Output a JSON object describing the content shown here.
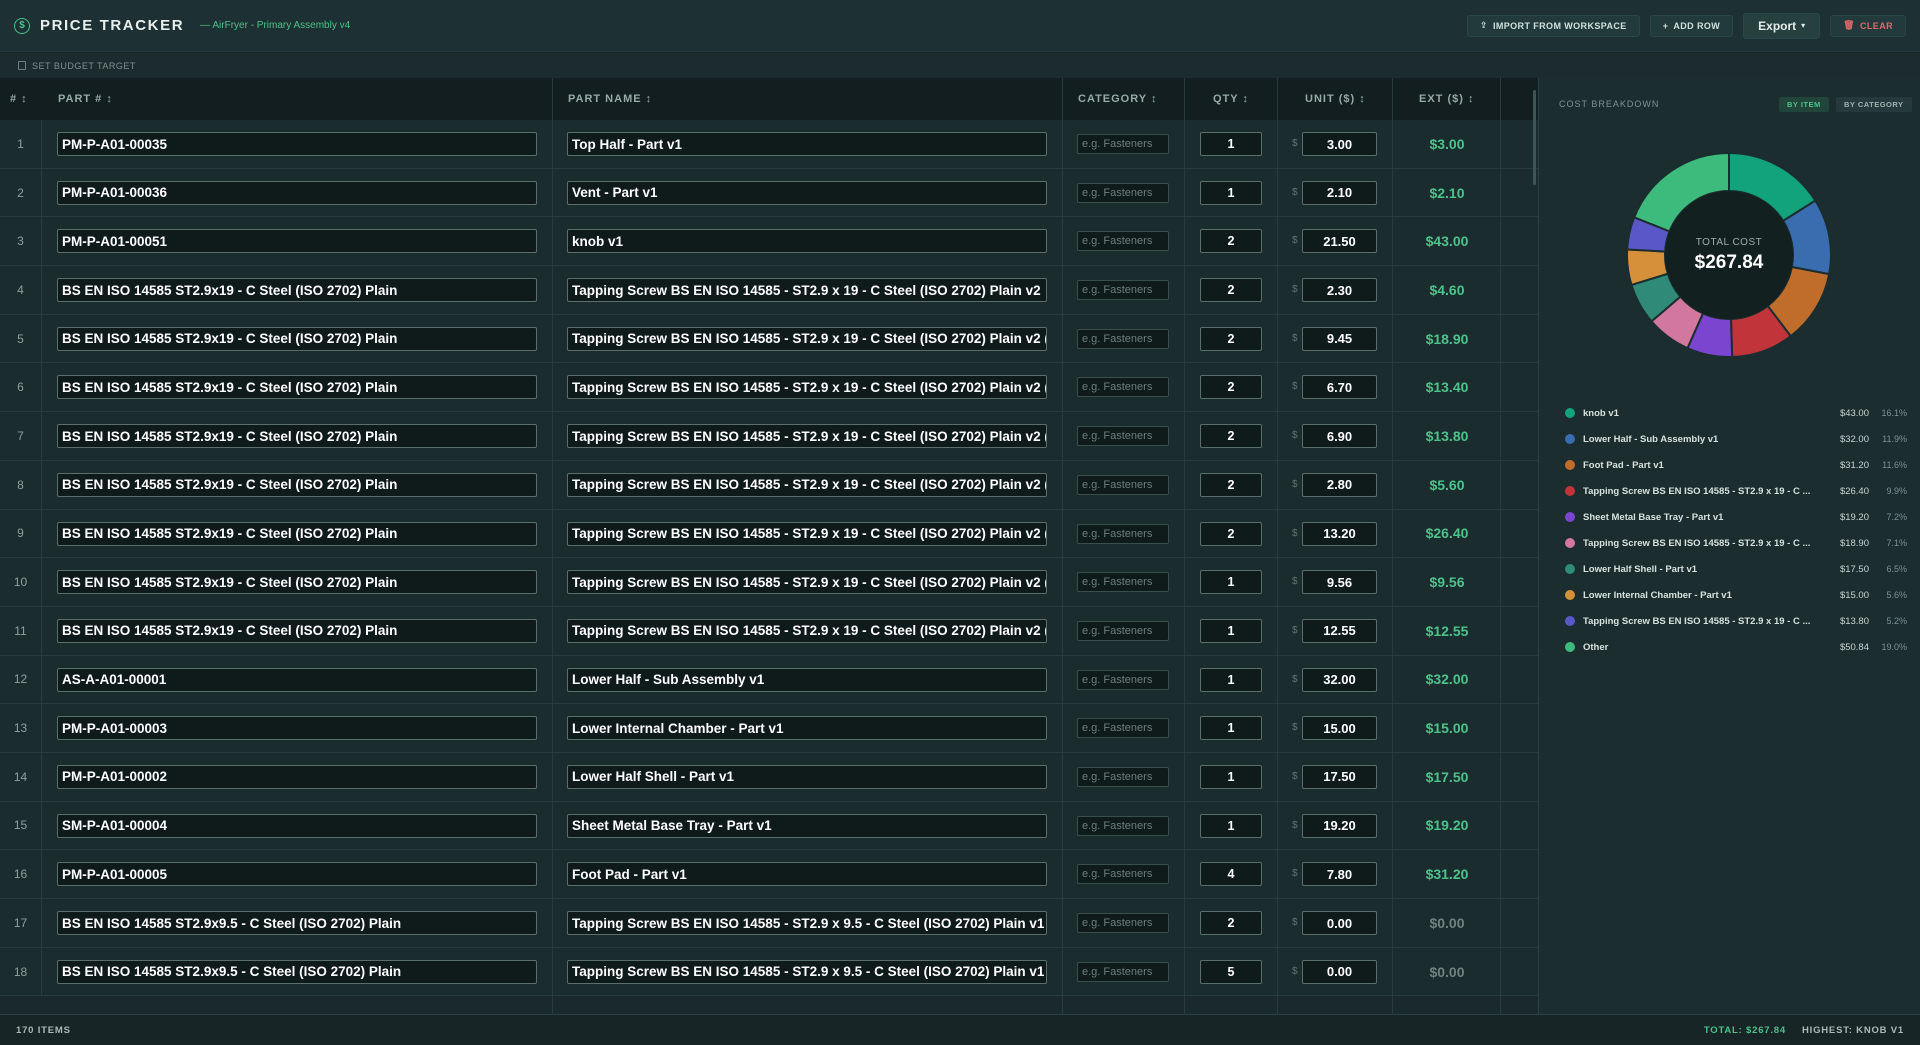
{
  "app": {
    "title": "PRICE TRACKER",
    "project": "— AirFryer - Primary Assembly v4",
    "logo": "dollar-icon"
  },
  "toolbar": {
    "import": "IMPORT FROM WORKSPACE",
    "add_row": "ADD ROW",
    "export": "Export",
    "clear": "CLEAR"
  },
  "subbar": {
    "budget": "SET BUDGET TARGET"
  },
  "columns": {
    "num": "#",
    "part": "PART #",
    "name": "PART NAME",
    "category": "CATEGORY",
    "qty": "QTY",
    "unit": "UNIT ($)",
    "ext": "EXT ($)"
  },
  "category_placeholder": "e.g. Fasteners",
  "rows": [
    {
      "n": "1",
      "part": "PM-P-A01-00035",
      "name": "Top Half - Part v1",
      "qty": "1",
      "unit": "3.00",
      "ext": "$3.00"
    },
    {
      "n": "2",
      "part": "PM-P-A01-00036",
      "name": "Vent - Part v1",
      "qty": "1",
      "unit": "2.10",
      "ext": "$2.10"
    },
    {
      "n": "3",
      "part": "PM-P-A01-00051",
      "name": "knob v1",
      "qty": "2",
      "unit": "21.50",
      "ext": "$43.00"
    },
    {
      "n": "4",
      "part": "BS EN ISO 14585 ST2.9x19 - C Steel (ISO 2702) Plain",
      "name": "Tapping Screw BS EN ISO 14585 - ST2.9 x 19 - C Steel (ISO 2702) Plain v2",
      "qty": "2",
      "unit": "2.30",
      "ext": "$4.60"
    },
    {
      "n": "5",
      "part": "BS EN ISO 14585 ST2.9x19 - C Steel (ISO 2702) Plain",
      "name": "Tapping Screw BS EN ISO 14585 - ST2.9 x 19 - C Steel (ISO 2702) Plain v2 (",
      "qty": "2",
      "unit": "9.45",
      "ext": "$18.90"
    },
    {
      "n": "6",
      "part": "BS EN ISO 14585 ST2.9x19 - C Steel (ISO 2702) Plain",
      "name": "Tapping Screw BS EN ISO 14585 - ST2.9 x 19 - C Steel (ISO 2702) Plain v2 (",
      "qty": "2",
      "unit": "6.70",
      "ext": "$13.40"
    },
    {
      "n": "7",
      "part": "BS EN ISO 14585 ST2.9x19 - C Steel (ISO 2702) Plain",
      "name": "Tapping Screw BS EN ISO 14585 - ST2.9 x 19 - C Steel (ISO 2702) Plain v2 (",
      "qty": "2",
      "unit": "6.90",
      "ext": "$13.80"
    },
    {
      "n": "8",
      "part": "BS EN ISO 14585 ST2.9x19 - C Steel (ISO 2702) Plain",
      "name": "Tapping Screw BS EN ISO 14585 - ST2.9 x 19 - C Steel (ISO 2702) Plain v2 (",
      "qty": "2",
      "unit": "2.80",
      "ext": "$5.60"
    },
    {
      "n": "9",
      "part": "BS EN ISO 14585 ST2.9x19 - C Steel (ISO 2702) Plain",
      "name": "Tapping Screw BS EN ISO 14585 - ST2.9 x 19 - C Steel (ISO 2702) Plain v2 (",
      "qty": "2",
      "unit": "13.20",
      "ext": "$26.40"
    },
    {
      "n": "10",
      "part": "BS EN ISO 14585 ST2.9x19 - C Steel (ISO 2702) Plain",
      "name": "Tapping Screw BS EN ISO 14585 - ST2.9 x 19 - C Steel (ISO 2702) Plain v2 (",
      "qty": "1",
      "unit": "9.56",
      "ext": "$9.56"
    },
    {
      "n": "11",
      "part": "BS EN ISO 14585 ST2.9x19 - C Steel (ISO 2702) Plain",
      "name": "Tapping Screw BS EN ISO 14585 - ST2.9 x 19 - C Steel (ISO 2702) Plain v2 (",
      "qty": "1",
      "unit": "12.55",
      "ext": "$12.55"
    },
    {
      "n": "12",
      "part": "AS-A-A01-00001",
      "name": "Lower Half - Sub Assembly v1",
      "qty": "1",
      "unit": "32.00",
      "ext": "$32.00"
    },
    {
      "n": "13",
      "part": "PM-P-A01-00003",
      "name": "Lower Internal Chamber - Part v1",
      "qty": "1",
      "unit": "15.00",
      "ext": "$15.00"
    },
    {
      "n": "14",
      "part": "PM-P-A01-00002",
      "name": "Lower Half Shell - Part v1",
      "qty": "1",
      "unit": "17.50",
      "ext": "$17.50"
    },
    {
      "n": "15",
      "part": "SM-P-A01-00004",
      "name": "Sheet Metal Base Tray - Part v1",
      "qty": "1",
      "unit": "19.20",
      "ext": "$19.20"
    },
    {
      "n": "16",
      "part": "PM-P-A01-00005",
      "name": "Foot Pad - Part v1",
      "qty": "4",
      "unit": "7.80",
      "ext": "$31.20"
    },
    {
      "n": "17",
      "part": "BS EN ISO 14585 ST2.9x9.5 - C Steel (ISO 2702) Plain",
      "name": "Tapping Screw BS EN ISO 14585 - ST2.9 x 9.5 - C Steel (ISO 2702) Plain v1",
      "qty": "2",
      "unit": "0.00",
      "ext": "$0.00"
    },
    {
      "n": "18",
      "part": "BS EN ISO 14585 ST2.9x9.5 - C Steel (ISO 2702) Plain",
      "name": "Tapping Screw BS EN ISO 14585 - ST2.9 x 9.5 - C Steel (ISO 2702) Plain v1",
      "qty": "5",
      "unit": "0.00",
      "ext": "$0.00"
    }
  ],
  "breakdown": {
    "title": "COST BREAKDOWN",
    "by_item": "BY ITEM",
    "by_category": "BY CATEGORY",
    "total_label": "TOTAL COST",
    "total_value": "$267.84"
  },
  "chart_data": {
    "type": "pie",
    "categories": [
      "knob v1",
      "Lower Half - Sub Assembly v1",
      "Foot Pad - Part v1",
      "Tapping Screw BS EN ISO 14585 - ST2.9 x 19 - C ...",
      "Sheet Metal Base Tray - Part v1",
      "Tapping Screw BS EN ISO 14585 - ST2.9 x 19 - C ...",
      "Lower Half Shell - Part v1",
      "Lower Internal Chamber - Part v1",
      "Tapping Screw BS EN ISO 14585 - ST2.9 x 19 - C ...",
      "Other"
    ],
    "values": [
      43.0,
      32.0,
      31.2,
      26.4,
      19.2,
      18.9,
      17.5,
      15.0,
      13.8,
      50.84
    ],
    "value_labels": [
      "$43.00",
      "$32.00",
      "$31.20",
      "$26.40",
      "$19.20",
      "$18.90",
      "$17.50",
      "$15.00",
      "$13.80",
      "$50.84"
    ],
    "percents": [
      "16.1%",
      "11.9%",
      "11.6%",
      "9.9%",
      "7.2%",
      "7.1%",
      "6.5%",
      "5.6%",
      "5.2%",
      "19.0%"
    ],
    "colors": [
      "#12a37a",
      "#3a6db0",
      "#c06d2c",
      "#c0343a",
      "#7c45cf",
      "#d2789e",
      "#2f8a78",
      "#d6903a",
      "#5a58c8",
      "#3dbb7d"
    ]
  },
  "footer": {
    "items": "170 ITEMS",
    "total": "TOTAL: $267.84",
    "highest": "HIGHEST: KNOB V1"
  }
}
